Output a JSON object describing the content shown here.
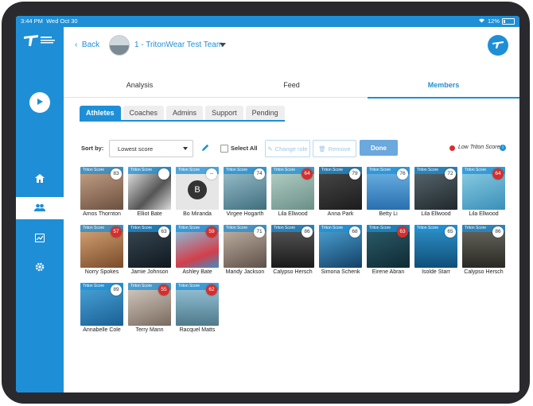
{
  "status": {
    "time": "3:44 PM",
    "date": "Wed Oct 30",
    "battery": "12%"
  },
  "topbar": {
    "back_label": "Back",
    "team_name": "1 - TritonWear Test Team"
  },
  "main_tabs": [
    {
      "label": "Analysis",
      "active": false
    },
    {
      "label": "Feed",
      "active": false
    },
    {
      "label": "Members",
      "active": true
    }
  ],
  "sub_tabs": [
    {
      "label": "Athletes",
      "active": true
    },
    {
      "label": "Coaches",
      "active": false
    },
    {
      "label": "Admins",
      "active": false
    },
    {
      "label": "Support",
      "active": false
    },
    {
      "label": "Pending",
      "active": false
    }
  ],
  "toolbar": {
    "sort_label": "Sort by:",
    "sort_value": "Lowest score",
    "select_all": "Select All",
    "change_role": "Change role",
    "remove": "Remove",
    "done": "Done",
    "legend": "Low Triton Score",
    "info": "i"
  },
  "colors": {
    "accent": "#1e8fd6",
    "low": "#d32f2f"
  },
  "card_label": "Triton Score",
  "athletes": [
    {
      "name": "Amos Thornton",
      "score": "83",
      "low": false,
      "bg": "linear-gradient(160deg,#c9a58a,#6b4f3f)"
    },
    {
      "name": "Elliot Bate",
      "score": "",
      "low": false,
      "bg": "linear-gradient(135deg,#eeeeee,#555555 60%,#dddddd)"
    },
    {
      "name": "Bo Miranda",
      "score": "--",
      "low": false,
      "bg": "#e6e6e6",
      "initial": "B"
    },
    {
      "name": "Virgee Hogarth",
      "score": "74",
      "low": false,
      "bg": "linear-gradient(160deg,#9fc3cf,#3f6e7e)"
    },
    {
      "name": "Lila Ellwood",
      "score": "64",
      "low": true,
      "bg": "linear-gradient(160deg,#b8d3c8,#6a8f88)"
    },
    {
      "name": "Anna Park",
      "score": "79",
      "low": false,
      "bg": "linear-gradient(160deg,#4a4a4a,#1c1c1c)"
    },
    {
      "name": "Betty Li",
      "score": "76",
      "low": false,
      "bg": "linear-gradient(180deg,#6fb6e6,#2a6fb0)"
    },
    {
      "name": "Lila Ellwood",
      "score": "72",
      "low": false,
      "bg": "linear-gradient(160deg,#5a6a72,#20282c)"
    },
    {
      "name": "Lila Ellwood",
      "score": "64",
      "low": true,
      "bg": "linear-gradient(160deg,#8fd0e6,#3a8fb8)"
    },
    {
      "name": "Norry Spokes",
      "score": "57",
      "low": true,
      "bg": "linear-gradient(160deg,#d9a877,#7a4a2a)"
    },
    {
      "name": "Jamie Johnson",
      "score": "63",
      "low": false,
      "bg": "linear-gradient(160deg,#3a4a55,#101820)"
    },
    {
      "name": "Ashley Bate",
      "score": "59",
      "low": true,
      "bg": "linear-gradient(160deg,#7fd0ee,#d23f4a 70%,#3a8fc8)"
    },
    {
      "name": "Mandy Jackson",
      "score": "71",
      "low": false,
      "bg": "linear-gradient(160deg,#c6b7a8,#5e5048)"
    },
    {
      "name": "Calypso Hersch",
      "score": "86",
      "low": false,
      "bg": "linear-gradient(180deg,#5a5a5a,#1a1a1a)"
    },
    {
      "name": "Simona Schenk",
      "score": "68",
      "low": false,
      "bg": "linear-gradient(160deg,#4fa7d8,#123f66)"
    },
    {
      "name": "Eirene Abran",
      "score": "63",
      "low": true,
      "bg": "linear-gradient(160deg,#2d5f6e,#0f2a33)"
    },
    {
      "name": "Isolde Starr",
      "score": "65",
      "low": false,
      "bg": "linear-gradient(180deg,#2f93c9,#0e4f7a)"
    },
    {
      "name": "Calypso Hersch",
      "score": "86",
      "low": false,
      "bg": "linear-gradient(180deg,#6a6a60,#2a2a24)"
    },
    {
      "name": "Annabelle Cole",
      "score": "89",
      "low": false,
      "bg": "linear-gradient(160deg,#4aa7dc,#1a5f94)"
    },
    {
      "name": "Terry Mann",
      "score": "55",
      "low": true,
      "bg": "linear-gradient(160deg,#d8cfc6,#7a6a5e)"
    },
    {
      "name": "Racquel Matts",
      "score": "62",
      "low": true,
      "bg": "linear-gradient(180deg,#9ac8dc,#4f7a8c)"
    }
  ]
}
